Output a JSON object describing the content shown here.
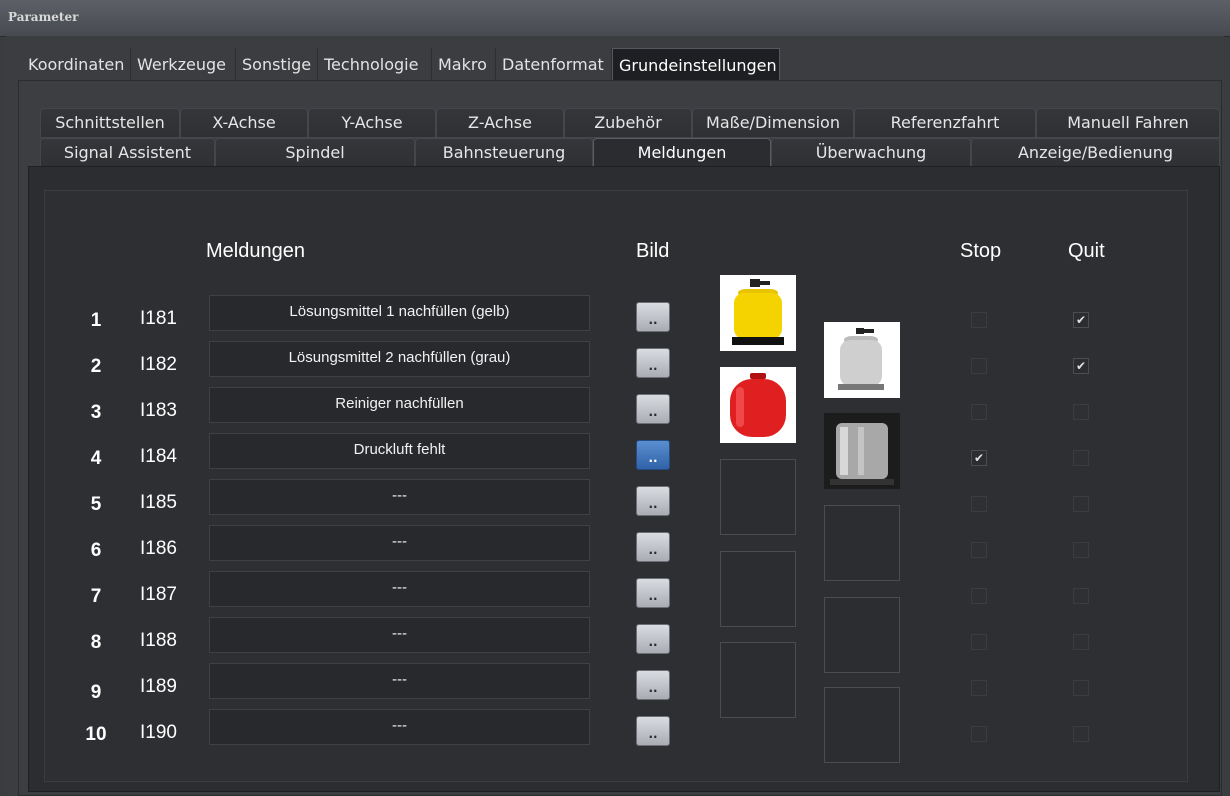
{
  "window": {
    "title": "Parameter"
  },
  "top_tabs": [
    {
      "label": "Koordinaten",
      "active": false
    },
    {
      "label": "Werkzeuge",
      "active": false
    },
    {
      "label": "Sonstige",
      "active": false
    },
    {
      "label": "Technologie",
      "active": false
    },
    {
      "label": "Makro",
      "active": false
    },
    {
      "label": "Datenformat",
      "active": false
    },
    {
      "label": "Grundeinstellungen",
      "active": true
    }
  ],
  "sub_tabs_row1": [
    {
      "label": "Schnittstellen"
    },
    {
      "label": "X-Achse"
    },
    {
      "label": "Y-Achse"
    },
    {
      "label": "Z-Achse"
    },
    {
      "label": "Zubehör"
    },
    {
      "label": "Maße/Dimension"
    },
    {
      "label": "Referenzfahrt"
    },
    {
      "label": "Manuell Fahren"
    }
  ],
  "sub_tabs_row2": [
    {
      "label": "Signal Assistent",
      "active": false
    },
    {
      "label": "Spindel",
      "active": false
    },
    {
      "label": "Bahnsteuerung",
      "active": false
    },
    {
      "label": "Meldungen",
      "active": true
    },
    {
      "label": "Überwachung",
      "active": false
    },
    {
      "label": "Anzeige/Bedienung",
      "active": false
    }
  ],
  "headers": {
    "meldungen": "Meldungen",
    "bild": "Bild",
    "stop": "Stop",
    "quit": "Quit"
  },
  "button_label": "..",
  "rows": [
    {
      "num": "1",
      "code": "I181",
      "text": "Lösungsmittel 1 nachfüllen (gelb)",
      "stop": false,
      "quit": true,
      "btn_active": false
    },
    {
      "num": "2",
      "code": "I182",
      "text": "Lösungsmittel 2 nachfüllen (grau)",
      "stop": false,
      "quit": true,
      "btn_active": false
    },
    {
      "num": "3",
      "code": "I183",
      "text": "Reiniger nachfüllen",
      "stop": false,
      "quit": false,
      "btn_active": false
    },
    {
      "num": "4",
      "code": "I184",
      "text": "Druckluft fehlt",
      "stop": true,
      "quit": false,
      "btn_active": true
    },
    {
      "num": "5",
      "code": "I185",
      "text": "---",
      "stop": false,
      "quit": false,
      "btn_active": false
    },
    {
      "num": "6",
      "code": "I186",
      "text": "---",
      "stop": false,
      "quit": false,
      "btn_active": false
    },
    {
      "num": "7",
      "code": "I187",
      "text": "---",
      "stop": false,
      "quit": false,
      "btn_active": false
    },
    {
      "num": "8",
      "code": "I188",
      "text": "---",
      "stop": false,
      "quit": false,
      "btn_active": false
    },
    {
      "num": "9",
      "code": "I189",
      "text": "---",
      "stop": false,
      "quit": false,
      "btn_active": false
    },
    {
      "num": "10",
      "code": "I190",
      "text": "---",
      "stop": false,
      "quit": false,
      "btn_active": false
    }
  ],
  "images": [
    {
      "icon": "yellow-gas-bottle-icon",
      "color": "#f2cf00"
    },
    {
      "icon": "grey-gas-bottle-icon",
      "color": "#c8c8c8"
    },
    {
      "icon": "red-gas-cylinder-icon",
      "color": "#e02020"
    },
    {
      "icon": "steel-tank-icon",
      "color": "#9a9a9a"
    },
    {
      "icon": "empty-image-slot",
      "color": ""
    },
    {
      "icon": "empty-image-slot",
      "color": ""
    },
    {
      "icon": "empty-image-slot",
      "color": ""
    },
    {
      "icon": "empty-image-slot",
      "color": ""
    },
    {
      "icon": "empty-image-slot",
      "color": ""
    },
    {
      "icon": "empty-image-slot",
      "color": ""
    }
  ]
}
